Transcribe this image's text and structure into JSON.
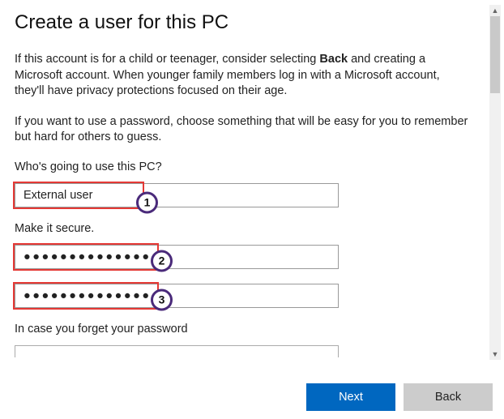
{
  "title": "Create a user for this PC",
  "intro1_pre": "If this account is for a child or teenager, consider selecting ",
  "intro1_bold": "Back",
  "intro1_post": " and creating a Microsoft account. When younger family members log in with a Microsoft account, they'll have privacy protections focused on their age.",
  "intro2": "If you want to use a password, choose something that will be easy for you to remember but hard for others to guess.",
  "who_label": "Who's going to use this PC?",
  "username_value": "External user",
  "secure_label": "Make it secure.",
  "password_mask": "●●●●●●●●●●●●●●",
  "confirm_mask": "●●●●●●●●●●●●●●",
  "forget_label": "In case you forget your password",
  "annotation_1": "1",
  "annotation_2": "2",
  "annotation_3": "3",
  "next_label": "Next",
  "back_label": "Back"
}
